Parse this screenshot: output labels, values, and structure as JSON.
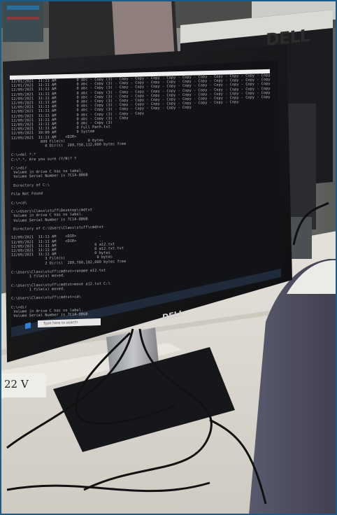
{
  "scene": {
    "background_brand_logo": "DELL",
    "monitor_brand_logo": "DELL",
    "desk_label": "22 V",
    "taskbar_search_placeholder": "Type here to search",
    "colors": {
      "screen": "#111316",
      "bezel": "#1a1a1c",
      "desk": "#dcd8cf",
      "frame": "#1e5a86"
    }
  },
  "cmd_lines": [
    "12/01/2021  11:11 AM         0 abc - Copy (3) - Copy - Copy - Copy - Copy - Copy - Copy - Copy - Copy - Copy - Copy - Copy - Copy - Copy - Copy - Cop",
    "12/01/2021  11:11 AM         0 abc - Copy (3) - Copy - Copy - Copy - Copy - Copy - Copy - Copy - Copy - Copy - Copy - Copy - Copy - Copy - Copy",
    "12/09/2021  11:11 AM         0 abc - Copy (3) - Copy - Copy - Copy - Copy - Copy - Copy - Copy - Copy - Copy - Copy - Copy - Copy - Copy",
    "12/09/2021  11:11 AM         0 abc - Copy (3) - Copy - Copy - Copy - Copy - Copy - Copy - Copy - Copy - Copy - Copy - Copy - Copy",
    "12/09/2021  11:11 AM         0 abc - Copy (3) - Copy - Copy - Copy - Copy - Copy - Copy - Copy - Copy - Copy - Copy - Copy",
    "12/09/2021  11:11 AM         0 abc - Copy (3) - Copy - Copy - Copy - Copy - Copy - Copy - Copy - Copy - Copy - Copy",
    "12/09/2021  11:11 AM         0 abc - Copy (3) - Copy - Copy - Copy - Copy - Copy - Copy - Copy - Copy",
    "12/09/2021  11:11 AM         0 abc - Copy (3) - Copy - Copy - Copy - Copy - Copy",
    "12/09/2021  11:11 AM         0 abc - Copy (3) - Copy - Copy",
    "12/09/2021  11:11 AM         0 abc - Copy (3) - Copy",
    "12/09/2021  11:11 AM         0 abc - Copy (3)",
    "12/09/2021  11:11 AM         0 Full Path.txt",
    "12/09/2021  10:00 AM         0 System",
    "12/09/2021  11:11 AM    <DIR>   ",
    "             899 File(s)          0 bytes",
    "               0 Dir(s)  289,758,112,000 bytes free",
    "",
    "C:\\>del *.*",
    "C:\\*.*, Are you sure (Y/N)? Y",
    "",
    "C:\\>dir",
    " Volume in drive C has no label.",
    " Volume Serial Number is 7C1A-8B6B",
    "",
    " Directory of C:\\",
    "",
    "File Not Found",
    "",
    "C:\\>cd\\",
    "",
    "C:\\>Users\\Class\\stuff\\Desktop\\cmdtxt",
    " Volume in drive C has no label.",
    " Volume Serial Number is 7C1A-8B6B",
    "",
    " Directory of C:\\Users\\Class\\stuff\\cmdtxt",
    "",
    "12/09/2021  11:11 AM    <DIR>          .",
    "12/09/2021  11:11 AM    <DIR>          ..",
    "12/09/2021  11:11 AM                 0 a12.txt",
    "12/09/2021  11:11 AM                 0 a12.txt.txt",
    "12/09/2021  11:11 AM                 0 bytes",
    "               3 File(s)              0 bytes",
    "               2 Dir(s)  289,760,182,000 bytes free",
    "",
    "C:\\Users\\Class\\stuff\\cmdtxt>rename a12.txt",
    "        1 file(s) moved.",
    "",
    "C:\\Users\\Class\\stuff\\cmdtxt>move a12.txt C:\\",
    "        1 file(s) moved.",
    "",
    "C:\\Users\\Class\\stuff\\cmdtxt>cd\\",
    "",
    "C:\\>dir",
    " Volume in drive C has no label.",
    " Volume Serial Number is 7C1A-8B6B",
    "",
    " Directory of C:\\",
    "",
    "12/09/2021  11:11 AM                 0 a12.txt",
    "               1 File(s)              0 bytes",
    "               0 Dir(s)  289,760,182,000 bytes free",
    "",
    "C:\\>_"
  ]
}
